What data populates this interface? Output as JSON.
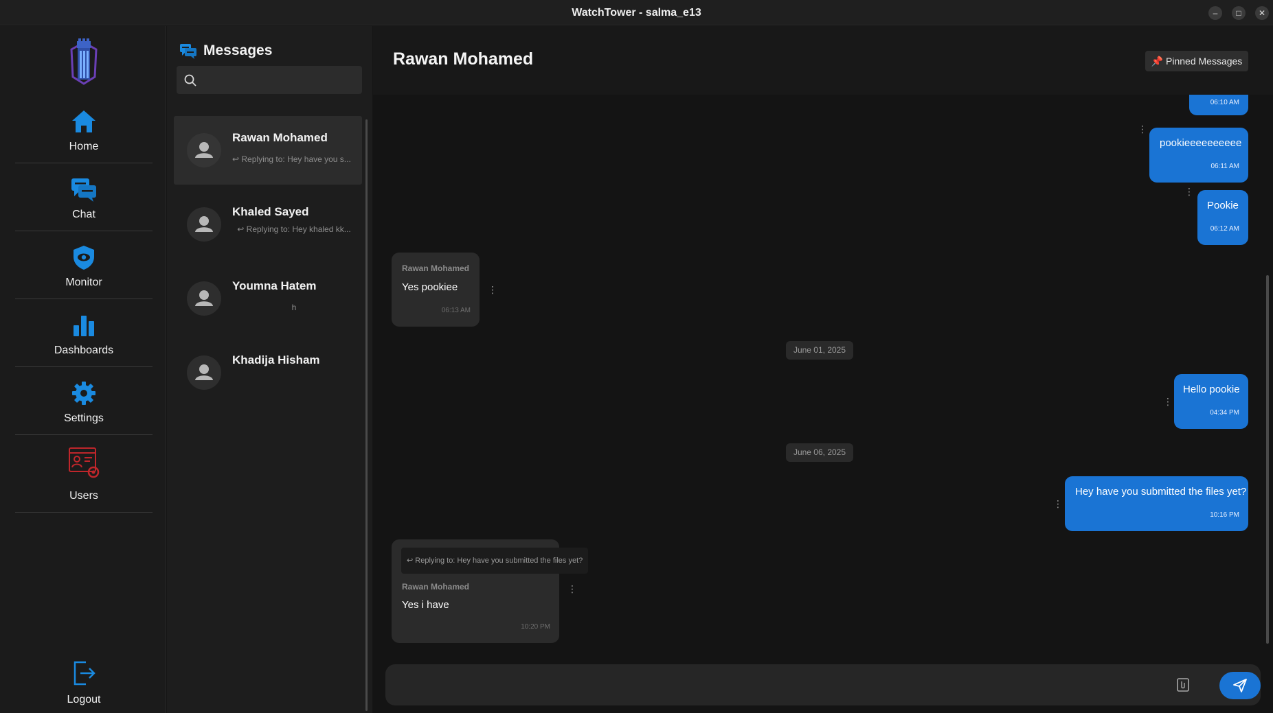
{
  "window": {
    "title": "WatchTower - salma_e13",
    "minimize": "–",
    "maximize": "□",
    "close": "✕"
  },
  "sidebar": {
    "items": [
      {
        "label": "Home",
        "icon": "home-icon"
      },
      {
        "label": "Chat",
        "icon": "chat-icon"
      },
      {
        "label": "Monitor",
        "icon": "shield-eye-icon"
      },
      {
        "label": "Dashboards",
        "icon": "bar-chart-icon"
      },
      {
        "label": "Settings",
        "icon": "gear-icon"
      },
      {
        "label": "Users",
        "icon": "users-admin-icon"
      }
    ],
    "logout": "Logout"
  },
  "conversations": {
    "title": "Messages",
    "search_placeholder": "",
    "items": [
      {
        "name": "Rawan Mohamed",
        "preview": "↩ Replying to: Hey have you s..."
      },
      {
        "name": "Khaled Sayed",
        "preview": "↩ Replying to: Hey khaled kk..."
      },
      {
        "name": "Youmna Hatem",
        "preview": "h"
      },
      {
        "name": "Khadija Hisham",
        "preview": ""
      }
    ]
  },
  "chat": {
    "contact_name": "Rawan Mohamed",
    "pinned_label": "📌 Pinned Messages",
    "messages": [
      {
        "direction": "out",
        "text": "",
        "time": "06:10 AM"
      },
      {
        "direction": "out",
        "text": "pookieeeeeeeeee",
        "time": "06:11 AM"
      },
      {
        "direction": "out",
        "text": "Pookie",
        "time": "06:12 AM"
      },
      {
        "direction": "in",
        "sender": "Rawan Mohamed",
        "text": "Yes pookiee",
        "time": "06:13 AM"
      },
      {
        "direction": "date",
        "text": "June 01, 2025"
      },
      {
        "direction": "out",
        "text": "Hello pookie",
        "time": "04:34 PM"
      },
      {
        "direction": "date",
        "text": "June 06, 2025"
      },
      {
        "direction": "out",
        "text": "Hey have you submitted the files yet?",
        "time": "10:16 PM"
      },
      {
        "direction": "in",
        "sender": "Rawan Mohamed",
        "reply": "↩ Replying to: Hey have you submitted the files yet?",
        "text": "Yes i have",
        "time": "10:20 PM"
      }
    ],
    "composer_placeholder": "",
    "colors": {
      "accent": "#1a74d4",
      "incoming": "#2b2b2b",
      "logout_icon": "#1a8ae0",
      "users_icon": "#c0262b"
    }
  }
}
